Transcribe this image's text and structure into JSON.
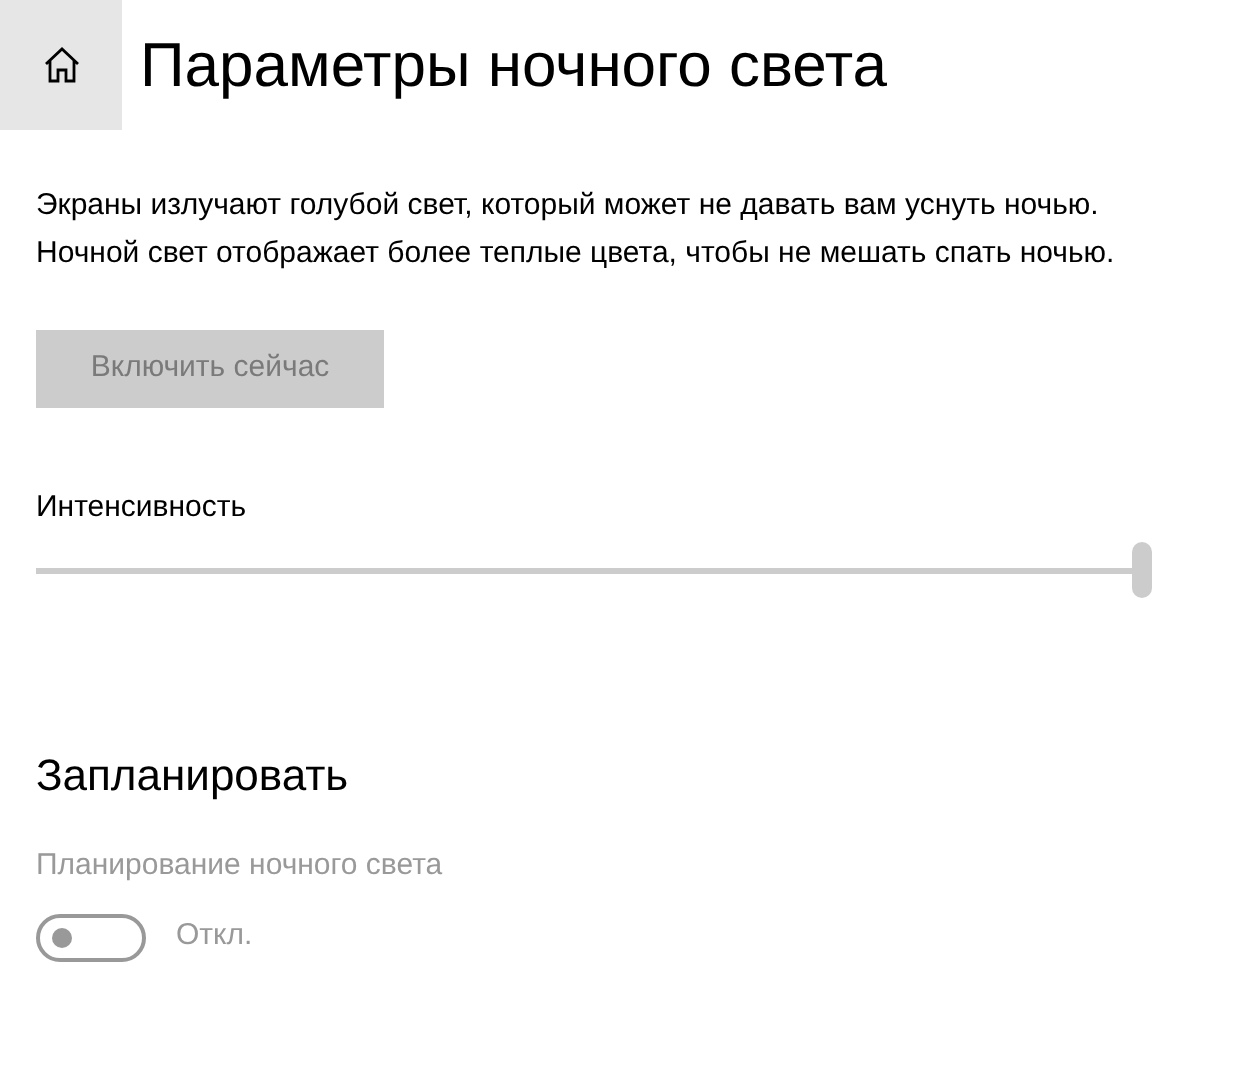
{
  "header": {
    "title": "Параметры ночного света"
  },
  "description": "Экраны излучают голубой свет, который может не давать вам уснуть ночью. Ночной свет отображает более теплые цвета, чтобы не мешать спать ночью.",
  "enable_button": {
    "label": "Включить сейчас",
    "disabled": true
  },
  "intensity": {
    "label": "Интенсивность",
    "level": 1.0,
    "disabled": true
  },
  "schedule": {
    "heading": "Запланировать",
    "label": "Планирование ночного света",
    "toggle": {
      "on": false,
      "disabled": true,
      "state_text": "Откл."
    }
  }
}
